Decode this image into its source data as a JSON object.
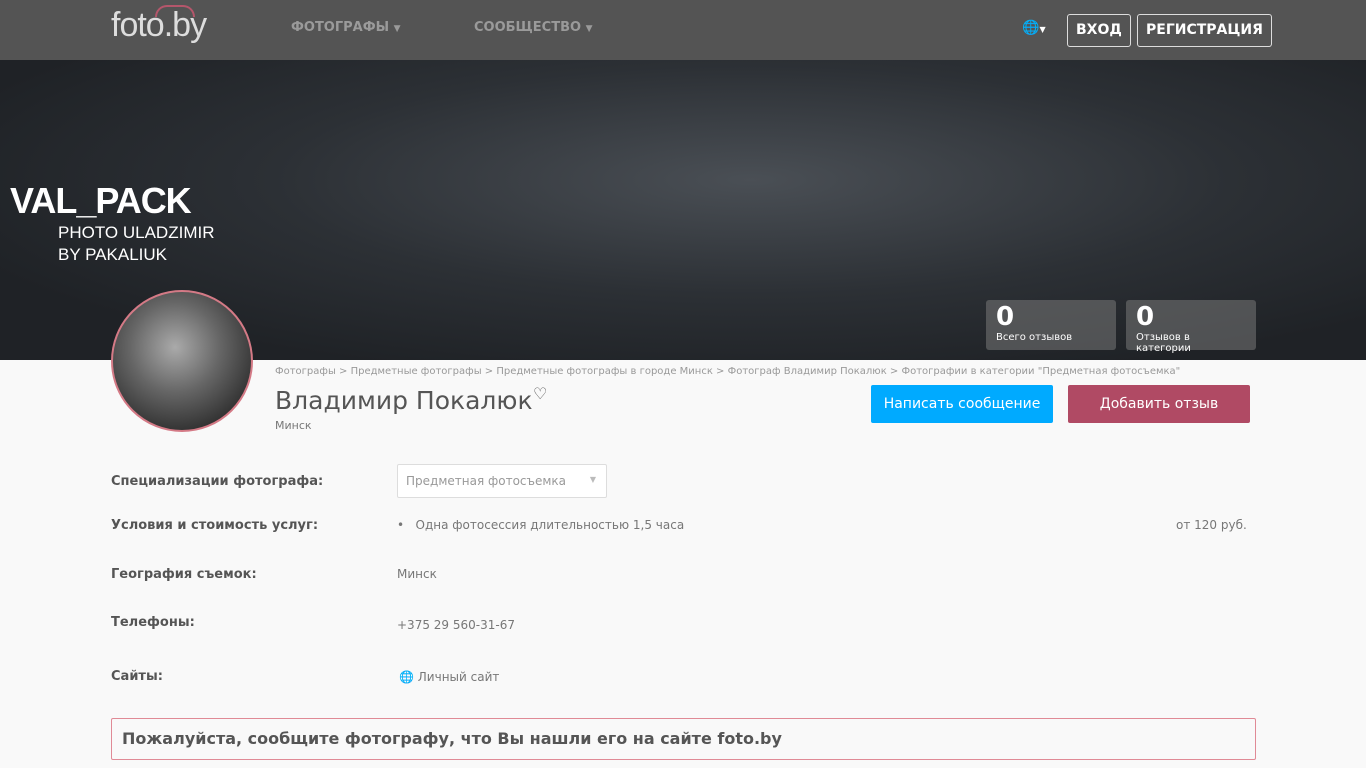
{
  "nav": {
    "logo": "foto.by",
    "photographers": "ФОТОГРАФЫ",
    "community": "СООБЩЕСТВО",
    "login": "ВХОД",
    "register": "РЕГИСТРАЦИЯ"
  },
  "hero": {
    "watermark_line1": "VAL_PACK",
    "watermark_line2": "PHOTO ULADZIMIR",
    "watermark_line3": "BY PAKALIUK"
  },
  "stats": [
    {
      "value": "0",
      "label": "Всего отзывов"
    },
    {
      "value": "0",
      "label": "Отзывов в категории"
    }
  ],
  "breadcrumb": "Фотографы > Предметные фотографы > Предметные фотографы в городе Минск > Фотограф Владимир Покалюк > Фотографии в категории \"Предметная фотосъемка\"",
  "profile": {
    "name": "Владимир Покалюк",
    "city": "Минск",
    "message_button": "Написать сообщение",
    "review_button": "Добавить отзыв"
  },
  "details": {
    "spec_label": "Специализации фотографа:",
    "spec_value": "Предметная фотосъемка",
    "terms_label": "Условия и стоимость услуг:",
    "terms_item": "Одна фотосессия длительностью 1,5 часа",
    "terms_price": "от 120 руб.",
    "geo_label": "География съемок:",
    "geo_value": "Минск",
    "phones_label": "Телефоны:",
    "phone": "+375 29 560-31-67",
    "sites_label": "Сайты:",
    "site": "Личный сайт"
  },
  "notice": "Пожалуйста, сообщите фотографу, что Вы нашли его на сайте foto.by"
}
